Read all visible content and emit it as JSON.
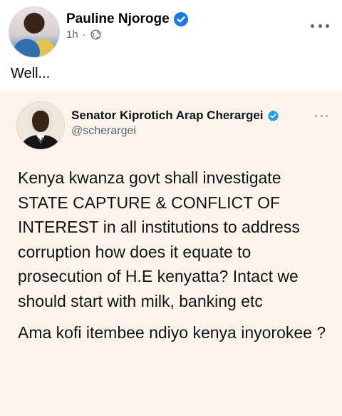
{
  "post": {
    "author": "Pauline Njoroge",
    "time": "1h",
    "separator": "·",
    "caption": "Well..."
  },
  "tweet": {
    "name": "Senator Kiprotich Arap Cherargei",
    "handle": "@scherargei",
    "paragraph1": "Kenya kwanza govt shall investigate STATE CAPTURE & CONFLICT OF INTEREST in all institutions to address corruption how does it equate to prosecution of H.E kenyatta? Intact we should start with milk, banking etc",
    "paragraph2": "Ama kofi itembee ndiyo kenya inyorokee ?"
  },
  "icons": {
    "post_verified": "verified-badge-icon",
    "audience": "globe-icon",
    "more": "more-options-icon"
  },
  "colors": {
    "verified_blue": "#1877f2",
    "tweet_background": "#fcf4ea",
    "secondary_text": "#65676b"
  }
}
